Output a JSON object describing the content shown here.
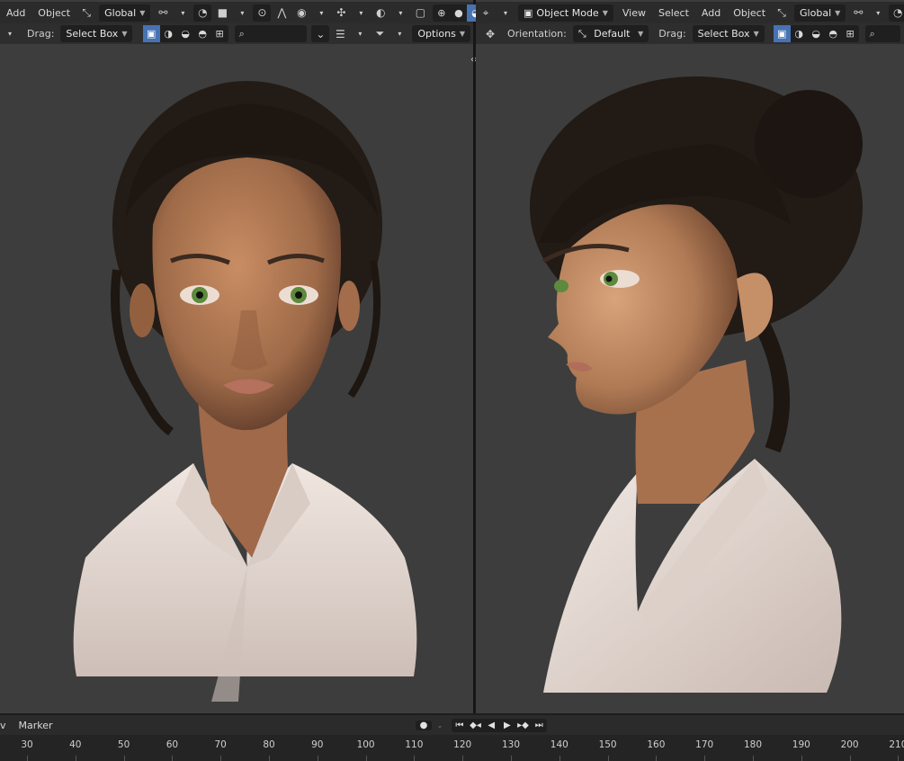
{
  "left_header": {
    "menu_add": "Add",
    "menu_object": "Object",
    "transform_orientation": "Global",
    "drag_label": "Drag:",
    "drag_value": "Select Box",
    "options_label": "Options"
  },
  "right_header": {
    "mode": "Object Mode",
    "menu_view": "View",
    "menu_select": "Select",
    "menu_add": "Add",
    "menu_object": "Object",
    "transform_orientation": "Global",
    "orientation_label": "Orientation:",
    "orientation_value": "Default",
    "drag_label": "Drag:",
    "drag_value": "Select Box"
  },
  "timeline": {
    "menu_view": "v",
    "menu_marker": "Marker",
    "ticks": [
      "30",
      "40",
      "50",
      "60",
      "70",
      "80",
      "90",
      "100",
      "110",
      "120",
      "130",
      "140",
      "150",
      "160",
      "170",
      "180",
      "190",
      "200",
      "210"
    ]
  },
  "colors": {
    "viewport_bg": "#3d3d3d",
    "header_bg": "#2b2b2b",
    "accent": "#4772b3",
    "skin": "#b47a55",
    "hair": "#221a15",
    "cloth": "#e8ddd6",
    "iris": "#5d8a3c"
  }
}
